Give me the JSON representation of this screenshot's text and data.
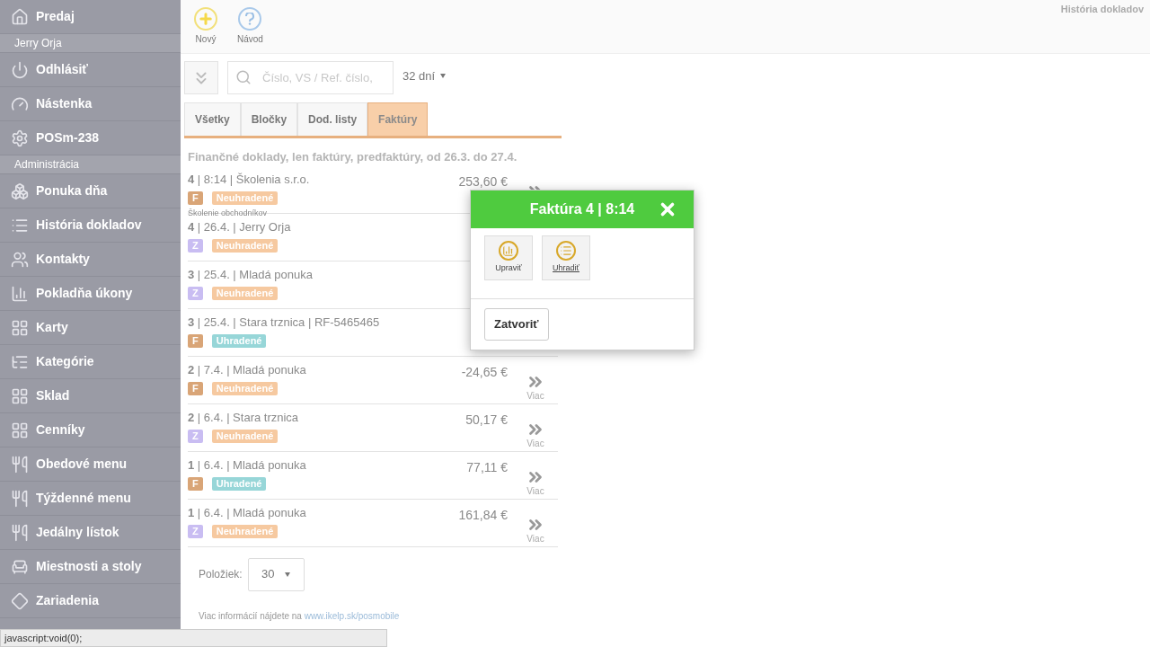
{
  "sidebar": {
    "items": [
      {
        "kind": "item",
        "label": "Predaj"
      },
      {
        "kind": "section",
        "label": "Jerry Orja"
      },
      {
        "kind": "item",
        "label": "Odhlásiť"
      },
      {
        "kind": "item",
        "label": "Nástenka"
      },
      {
        "kind": "item",
        "label": "POSm-238"
      },
      {
        "kind": "section",
        "label": "Administrácia"
      },
      {
        "kind": "item",
        "label": "Ponuka dňa"
      },
      {
        "kind": "item",
        "label": "História dokladov"
      },
      {
        "kind": "item",
        "label": "Kontakty"
      },
      {
        "kind": "item",
        "label": "Pokladňa úkony"
      },
      {
        "kind": "item",
        "label": "Karty"
      },
      {
        "kind": "item",
        "label": "Kategórie"
      },
      {
        "kind": "item",
        "label": "Sklad"
      },
      {
        "kind": "item",
        "label": "Cenníky"
      },
      {
        "kind": "item",
        "label": "Obedové menu"
      },
      {
        "kind": "item",
        "label": "Týždenné menu"
      },
      {
        "kind": "item",
        "label": "Jedálny lístok"
      },
      {
        "kind": "item",
        "label": "Miestnosti a stoly"
      },
      {
        "kind": "item",
        "label": "Zariadenia"
      }
    ]
  },
  "toolbar": [
    {
      "kind": "new",
      "label": "Nový"
    },
    {
      "kind": "help",
      "label": "Návod"
    }
  ],
  "page_title": "História dokladov",
  "search": {
    "placeholder": "Číslo, VS / Ref. číslo,"
  },
  "period": "32 dní",
  "tabs": [
    {
      "label": "Všetky",
      "selected": false
    },
    {
      "label": "Bločky",
      "selected": false
    },
    {
      "label": "Dod. listy",
      "selected": false
    },
    {
      "label": "Faktúry",
      "selected": true
    }
  ],
  "filter_caption": "Finančné doklady, len faktúry, predfaktúry, od 26.3. do 27.4.",
  "documents": [
    {
      "title": "**4** | 8:14 | Školenia s.r.o.",
      "amount": "253,60 €",
      "more_icon": true,
      "type": {
        "label": "F",
        "color": "#d9a577"
      },
      "status": {
        "label": "Neuhradené",
        "color": "#f6c9a0"
      },
      "note": "Školenie obchodníkov"
    },
    {
      "title": "**4** | 26.4. | Jerry Orja",
      "type": {
        "label": "Z",
        "color": "#c9bdf2"
      },
      "status": {
        "label": "Neuhradené",
        "color": "#f6c9a0"
      }
    },
    {
      "title": "**3** | 25.4. | Mladá ponuka",
      "type": {
        "label": "Z",
        "color": "#c9bdf2"
      },
      "status": {
        "label": "Neuhradené",
        "color": "#f6c9a0"
      }
    },
    {
      "title": "**3** | 25.4. | Stara trznica | RF-5465465",
      "type": {
        "label": "F",
        "color": "#d9a577"
      },
      "status": {
        "label": "Uhradené",
        "color": "#97d6d8"
      }
    },
    {
      "title": "**2** | 7.4. | Mladá ponuka",
      "amount": "-24,65 €",
      "more_icon": true,
      "more": "Viac",
      "type": {
        "label": "F",
        "color": "#d9a577"
      },
      "status": {
        "label": "Neuhradené",
        "color": "#f6c9a0"
      }
    },
    {
      "title": "**2** | 6.4. | Stara trznica",
      "amount": "50,17 €",
      "more_icon": true,
      "more": "Viac",
      "type": {
        "label": "Z",
        "color": "#c9bdf2"
      },
      "status": {
        "label": "Neuhradené",
        "color": "#f6c9a0"
      }
    },
    {
      "title": "**1** | 6.4. | Mladá ponuka",
      "amount": "77,11 €",
      "more_icon": true,
      "more": "Viac",
      "type": {
        "label": "F",
        "color": "#d9a577"
      },
      "status": {
        "label": "Uhradené",
        "color": "#97d6d8"
      }
    },
    {
      "title": "**1** | 6.4. | Mladá ponuka",
      "amount": "161,84 €",
      "more_icon": true,
      "more": "Viac",
      "type": {
        "label": "Z",
        "color": "#c9bdf2"
      },
      "status": {
        "label": "Neuhradené",
        "color": "#f6c9a0"
      }
    }
  ],
  "page_size": {
    "label": "Položiek:",
    "value": "30"
  },
  "footer": {
    "text": "Viac informácií nájdete na",
    "link": "www.ikelp.sk/posmobile"
  },
  "dialog": {
    "title": "Faktúra 4 | 8:14",
    "actions": [
      {
        "kind": "edit",
        "label": "Upraviť"
      },
      {
        "kind": "pay",
        "label": "Uhradiť"
      }
    ],
    "close_button": "Zatvoriť"
  },
  "status_bar": "javascript:void(0);"
}
